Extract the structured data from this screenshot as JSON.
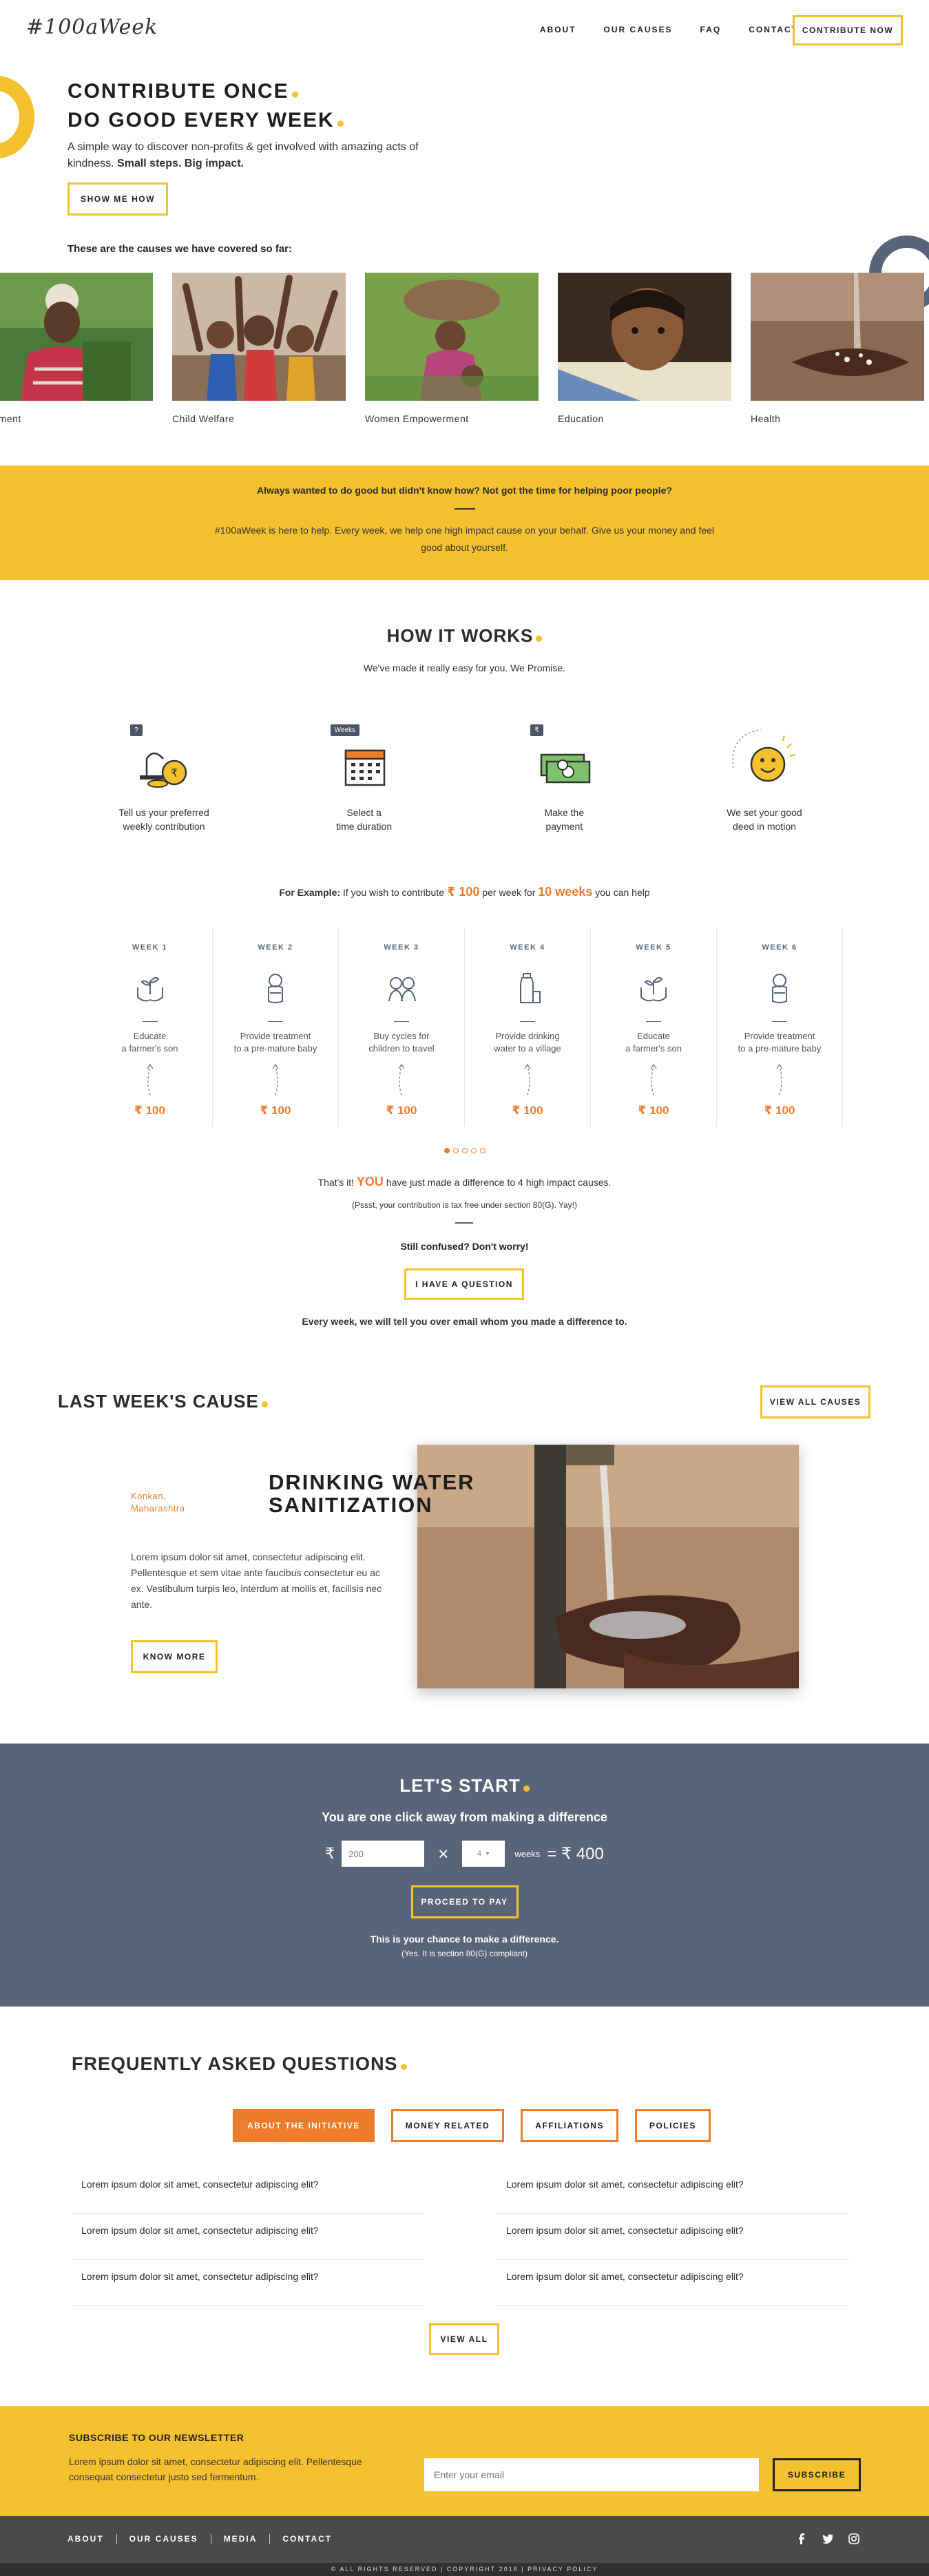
{
  "nav": {
    "logo": "#100aWeek",
    "items": [
      {
        "label": "ABOUT"
      },
      {
        "label": "OUR CAUSES"
      },
      {
        "label": "FAQ"
      },
      {
        "label": "CONTACT"
      }
    ],
    "cta": "CONTRIBUTE NOW"
  },
  "hero": {
    "title_line1": "CONTRIBUTE ONCE",
    "title_line2": "DO GOOD EVERY WEEK",
    "subtitle": "A simple way to discover non-profits & get involved with amazing acts of kindness.",
    "subtitle_bold": "Small steps. Big impact.",
    "button": "SHOW ME HOW",
    "causes_heading": "These are the causes we have covered so far:",
    "causes": [
      {
        "label": "ployment",
        "icon": "photo-farmer"
      },
      {
        "label": "Child Welfare",
        "icon": "photo-children"
      },
      {
        "label": "Women Empowerment",
        "icon": "photo-women"
      },
      {
        "label": "Education",
        "icon": "photo-girl"
      },
      {
        "label": "Health",
        "icon": "photo-water"
      }
    ]
  },
  "band": {
    "question": "Always wanted to do good but didn't know how? Not got the time for helping poor people?",
    "answer": "#100aWeek is here to help. Every week, we help one high impact cause on your behalf. Give us your money and feel good about yourself."
  },
  "how": {
    "title": "HOW IT WORKS",
    "subtitle": "We've made it really easy for you. We Promise.",
    "steps": [
      {
        "tag": "?",
        "line1": "Tell us your preferred",
        "line2": "weekly contribution",
        "icon": "coins-icon"
      },
      {
        "tag": "Weeks",
        "line1": "Select a",
        "line2": "time duration",
        "icon": "calendar-icon"
      },
      {
        "tag": "₹",
        "line1": "Make the",
        "line2": "payment",
        "icon": "money-icon"
      },
      {
        "tag": "",
        "line1": "We set your good",
        "line2": "deed in motion",
        "icon": "smiley-icon"
      }
    ],
    "example_prefix": "For Example:",
    "example_text1": "If you wish to contribute",
    "example_amount": "₹ 100",
    "example_text2": "per week for",
    "example_weeks": "10 weeks",
    "example_text3": "you can help",
    "weeks": [
      {
        "label": "WEEK 1",
        "line1": "Educate",
        "line2": "a farmer's son",
        "amount": "₹ 100",
        "icon": "plant-hands-icon"
      },
      {
        "label": "WEEK 2",
        "line1": "Provide treatment",
        "line2": "to a pre-mature baby",
        "amount": "₹ 100",
        "icon": "baby-icon"
      },
      {
        "label": "WEEK 3",
        "line1": "Buy cycles for",
        "line2": "children to travel",
        "amount": "₹ 100",
        "icon": "kids-icon"
      },
      {
        "label": "WEEK 4",
        "line1": "Provide drinking",
        "line2": "water to a village",
        "amount": "₹ 100",
        "icon": "bottle-icon"
      },
      {
        "label": "WEEK 5",
        "line1": "Educate",
        "line2": "a farmer's son",
        "amount": "₹ 100",
        "icon": "plant-hands-icon"
      },
      {
        "label": "WEEK 6",
        "line1": "Provide treatment",
        "line2": "to a pre-mature baby",
        "amount": "₹ 100",
        "icon": "baby-icon"
      }
    ],
    "made_text1": "That's it!",
    "made_you": "YOU",
    "made_text2": "have just made a difference to 4 high impact causes.",
    "pssst": "(Pssst, your contribution is tax free under section 80(G). Yay!)",
    "confused": "Still confused? Don't worry!",
    "question_button": "I HAVE A QUESTION",
    "every_week": "Every week, we will tell you over email whom you made a difference to."
  },
  "last_week": {
    "title": "LAST WEEK'S CAUSE",
    "view_all": "VIEW ALL CAUSES",
    "location_line1": "Konkan,",
    "location_line2": "Maharashtra",
    "heading_line1": "DRINKING WATER",
    "heading_line2": "SANITIZATION",
    "body": "Lorem ipsum dolor sit amet, consectetur adipiscing elit. Pellentesque et sem vitae ante faucibus consectetur eu ac ex. Vestibulum turpis leo, interdum at mollis et, facilisis nec ante.",
    "button": "KNOW MORE"
  },
  "start": {
    "title": "LET'S START",
    "subtitle": "You are one click away from making a difference",
    "currency": "₹",
    "amount_placeholder": "200",
    "times": "×",
    "weeks_value": "4",
    "weeks_word": "weeks",
    "total": "= ₹ 400",
    "button": "PROCEED TO PAY",
    "chance": "This is your chance to make a difference.",
    "compliant": "(Yes. It is section 80(G) compliant)"
  },
  "faq": {
    "title": "FREQUENTLY ASKED QUESTIONS",
    "tabs": [
      {
        "label": "ABOUT THE INITIATIVE"
      },
      {
        "label": "MONEY RELATED"
      },
      {
        "label": "AFFILIATIONS"
      },
      {
        "label": "POLICIES"
      }
    ],
    "left": [
      "Lorem ipsum dolor sit amet, consectetur adipiscing elit?",
      "Lorem ipsum dolor sit amet, consectetur adipiscing elit?",
      "Lorem ipsum dolor sit amet, consectetur adipiscing elit?"
    ],
    "right": [
      "Lorem ipsum dolor sit amet, consectetur adipiscing elit?",
      "Lorem ipsum dolor sit amet, consectetur adipiscing elit?",
      "Lorem ipsum dolor sit amet, consectetur adipiscing elit?"
    ],
    "view_all": "VIEW ALL"
  },
  "newsletter": {
    "title": "SUBSCRIBE TO OUR NEWSLETTER",
    "text": "Lorem ipsum dolor sit amet, consectetur adipiscing elit. Pellentesque consequat consectetur justo sed fermentum.",
    "placeholder": "Enter your email",
    "button": "SUBSCRIBE"
  },
  "footer": {
    "links": [
      {
        "label": "ABOUT"
      },
      {
        "label": "OUR CAUSES"
      },
      {
        "label": "MEDIA"
      },
      {
        "label": "CONTACT"
      }
    ],
    "social": [
      "facebook-icon",
      "twitter-icon",
      "instagram-icon"
    ],
    "copyright": "© ALL RIGHTS RESERVED | COPYRIGHT 2018 | PRIVACY POLICY"
  },
  "colors": {
    "accent": "#f6c12f",
    "orange": "#ef7c2a",
    "slate": "#5a6478"
  },
  "carousel": {
    "pages": 5,
    "active": 1
  }
}
